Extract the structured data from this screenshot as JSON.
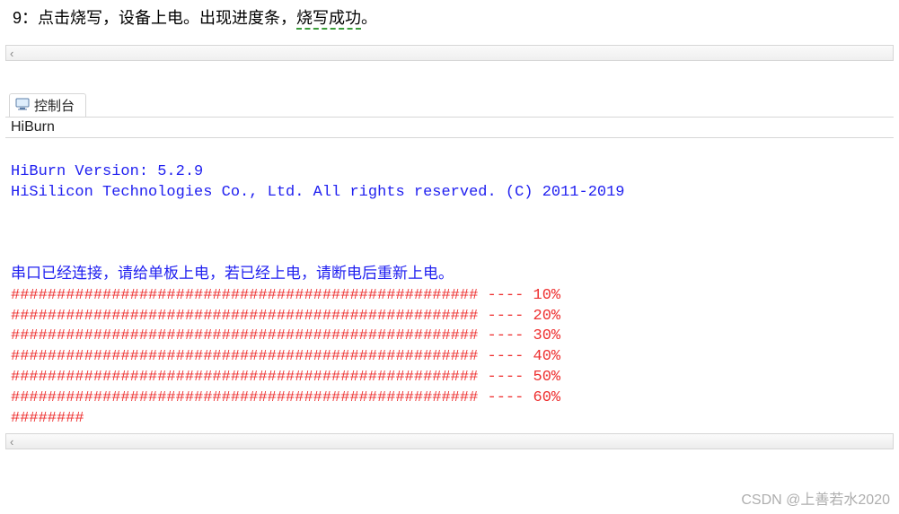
{
  "instruction": {
    "prefix": "9：点击烧写，设备上电。出现进度条，",
    "highlight": "烧写成功",
    "suffix": "。"
  },
  "scrollbar_left_arrow": "‹",
  "scrollbar_left_arrow_b": "‹",
  "tab": {
    "label": "控制台"
  },
  "subheader": "HiBurn",
  "console": {
    "version_line": "HiBurn Version: 5.2.9",
    "copyright_line": "HiSilicon Technologies Co., Ltd. All rights reserved. (C) 2011-2019",
    "connect_msg": "串口已经连接，请给单板上电，若已经上电，请断电后重新上电。",
    "progress": [
      "################################################### ---- 10%",
      "################################################### ---- 20%",
      "################################################### ---- 30%",
      "################################################### ---- 40%",
      "################################################### ---- 50%",
      "################################################### ---- 60%",
      "########"
    ]
  },
  "watermark": "CSDN @上善若水2020"
}
